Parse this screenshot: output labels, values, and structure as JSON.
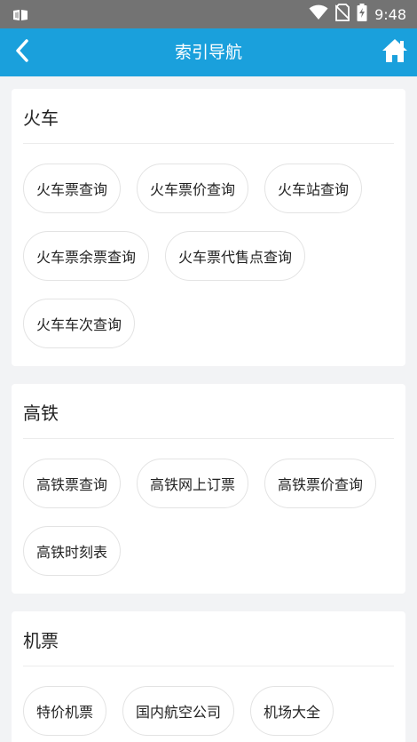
{
  "status_bar": {
    "time": "9:48",
    "icons": [
      "notification-icon",
      "wifi-icon",
      "no-sim-icon",
      "battery-charging-icon"
    ]
  },
  "app_bar": {
    "title": "索引导航",
    "back_icon": "chevron-left-icon",
    "home_icon": "home-icon",
    "color": "#1aa0dc"
  },
  "sections": [
    {
      "title": "火车",
      "items": [
        "火车票查询",
        "火车票价查询",
        "火车站查询",
        "火车票余票查询",
        "火车票代售点查询",
        "火车车次查询"
      ]
    },
    {
      "title": "高铁",
      "items": [
        "高铁票查询",
        "高铁网上订票",
        "高铁票价查询",
        "高铁时刻表"
      ]
    },
    {
      "title": "机票",
      "items": [
        "特价机票",
        "国内航空公司",
        "机场大全"
      ]
    }
  ]
}
